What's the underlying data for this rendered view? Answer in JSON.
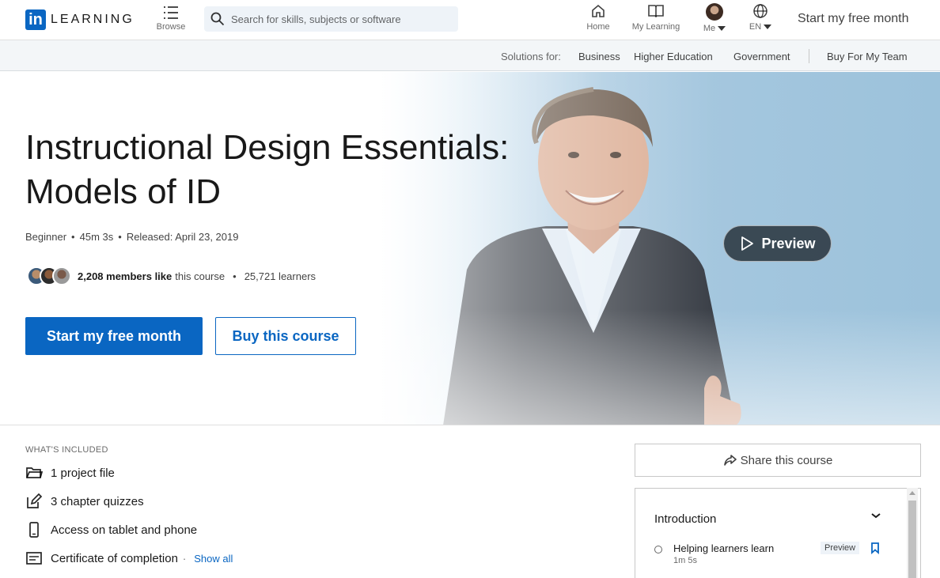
{
  "nav": {
    "logo_mark": "in",
    "logo_word": "LEARNING",
    "browse_label": "Browse",
    "search_placeholder": "Search for skills, subjects or software",
    "home_label": "Home",
    "mylearning_label": "My Learning",
    "me_label": "Me",
    "lang_label": "EN",
    "start_free": "Start my free month"
  },
  "subbar": {
    "solutions_label": "Solutions for:",
    "links": [
      "Business",
      "Higher Education",
      "Government"
    ],
    "buy_team": "Buy For My Team"
  },
  "course": {
    "title_line1": "Instructional Design Essentials:",
    "title_line2": "Models of ID",
    "level": "Beginner",
    "duration": "45m 3s",
    "released": "Released: April 23, 2019",
    "likes_count": "2,208 members like",
    "likes_suffix": "this course",
    "learners": "25,721 learners",
    "start_button": "Start my free month",
    "buy_button": "Buy this course",
    "preview_button": "Preview"
  },
  "included": {
    "heading": "WHAT'S INCLUDED",
    "items": [
      "1 project file",
      "3 chapter quizzes",
      "Access on tablet and phone",
      "Certificate of completion"
    ],
    "show_all": "Show all"
  },
  "sidebar": {
    "share_label": "Share this course",
    "section_title": "Introduction",
    "first_item_title": "Helping learners learn",
    "first_item_duration": "1m 5s",
    "preview_badge": "Preview"
  },
  "colors": {
    "brand_blue": "#0a66c2",
    "hero_bg": "#9cc2db"
  }
}
